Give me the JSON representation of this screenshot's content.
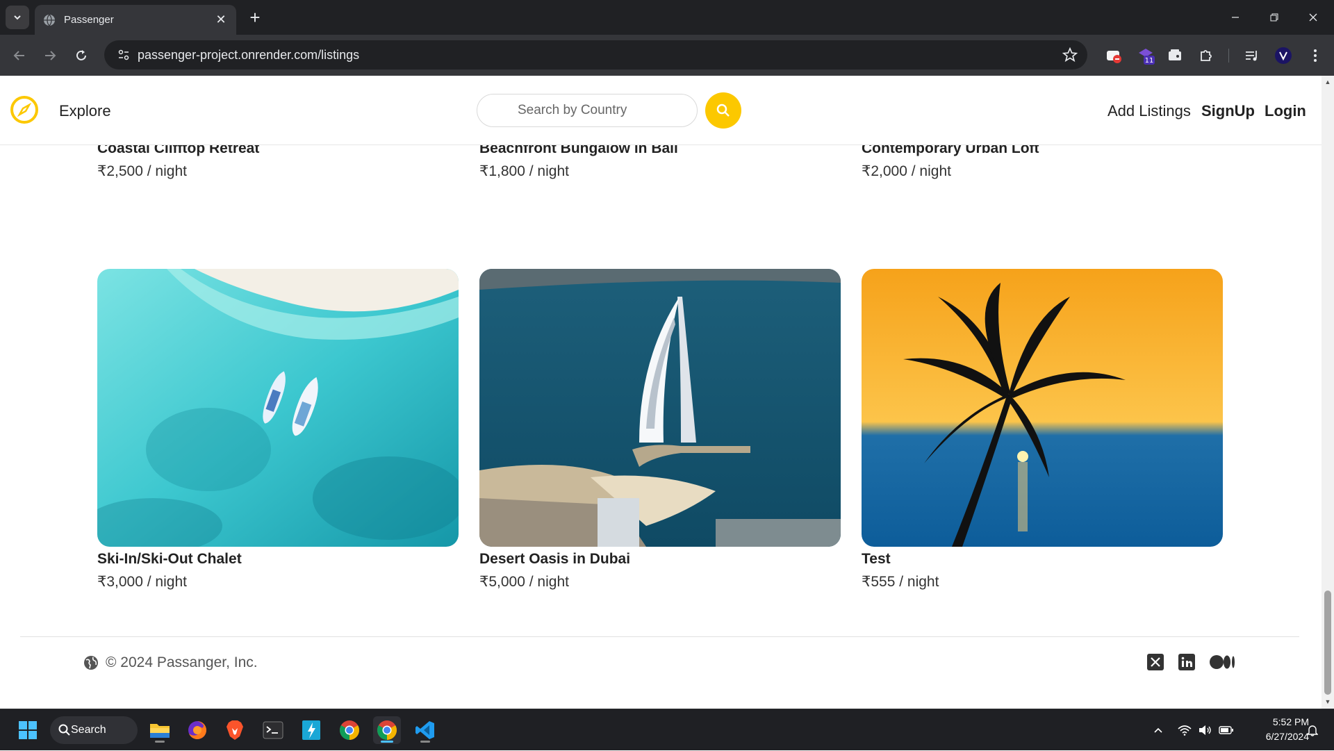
{
  "browser": {
    "tab_title": "Passenger",
    "url": "passenger-project.onrender.com/listings",
    "extension_badge": "11"
  },
  "site": {
    "explore_label": "Explore",
    "search_placeholder": "Search by Country",
    "nav_links": {
      "add_listings": "Add Listings",
      "signup": "SignUp",
      "login": "Login"
    },
    "brand_color": "#fcc800"
  },
  "listings": [
    {
      "title": "Coastal Clifftop Retreat",
      "price": "₹2,500",
      "per": " / night",
      "image": "tropical-lagoon-with-palm-leaves"
    },
    {
      "title": "Beachfront Bungalow in Bali",
      "price": "₹1,800",
      "per": " / night",
      "image": "lake-reflection-mountains"
    },
    {
      "title": "Contemporary Urban Loft",
      "price": "₹2,000",
      "per": " / night",
      "image": "dark-sofa-with-glass-wall"
    },
    {
      "title": "Ski-In/Ski-Out Chalet",
      "price": "₹3,000",
      "per": " / night",
      "image": "aerial-turquoise-water-two-boats"
    },
    {
      "title": "Desert Oasis in Dubai",
      "price": "₹5,000",
      "per": " / night",
      "image": "aerial-burj-al-arab-dubai"
    },
    {
      "title": "Test",
      "price": "₹555",
      "per": " / night",
      "image": "palm-tree-sunset-ocean"
    }
  ],
  "footer": {
    "copyright": "© 2024 Passanger, Inc.",
    "social": [
      "x-icon",
      "linkedin-icon",
      "medium-icon"
    ]
  },
  "taskbar": {
    "search_label": "Search",
    "time": "5:52 PM",
    "date": "6/27/2024"
  }
}
